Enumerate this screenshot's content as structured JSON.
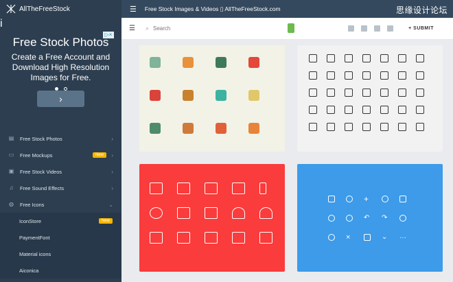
{
  "app": {
    "name": "AllTheFreeStock",
    "info": "i"
  },
  "ad": {
    "title": "Free Stock Photos",
    "body": "Create a Free Account and Download High Resolution Images for Free.",
    "arrow": "›"
  },
  "nav": {
    "items": [
      {
        "label": "Free Stock Photos",
        "icon": "image-icon"
      },
      {
        "label": "Free Mockups",
        "icon": "monitor-icon",
        "badge": "New"
      },
      {
        "label": "Free Stock Videos",
        "icon": "video-icon"
      },
      {
        "label": "Free Sound Effects",
        "icon": "music-icon"
      },
      {
        "label": "Free Icons",
        "icon": "globe-icon"
      }
    ],
    "subitems": [
      {
        "label": "IconStore",
        "badge": "New"
      },
      {
        "label": "PaymentFont"
      },
      {
        "label": "Material icons"
      },
      {
        "label": "Aiconica"
      }
    ]
  },
  "topbar": {
    "title": "Free Stock Images & Videos ▯ AllTheFreeStock.com"
  },
  "watermark": "思缘设计论坛",
  "search": {
    "placeholder": "Search",
    "submit": "+ SUBMIT"
  },
  "colors": {
    "sidebar": "#2c3e50",
    "red": "#fa3c3c",
    "blue": "#3d9be9",
    "cream": "#f3f2e7",
    "badge": "#f5b400"
  }
}
